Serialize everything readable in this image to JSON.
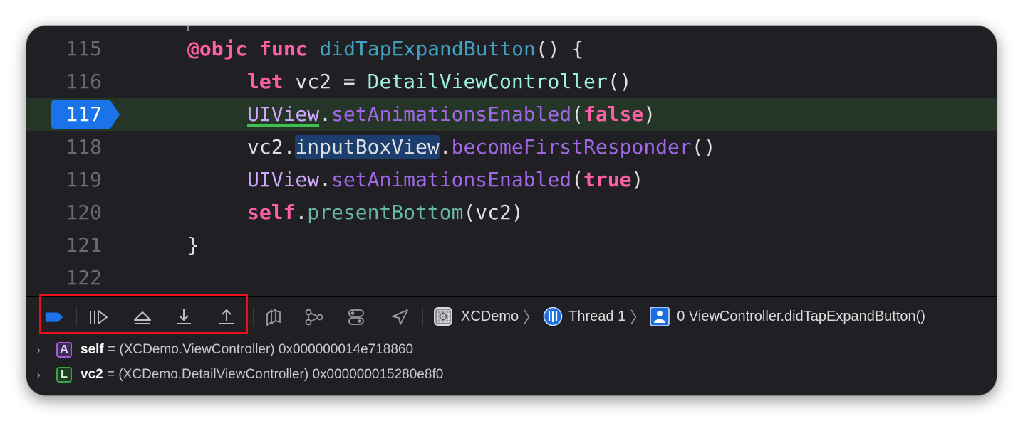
{
  "editor": {
    "lines": [
      {
        "num": "115",
        "segments": [
          {
            "t": "@objc",
            "c": "kw"
          },
          {
            "t": " ",
            "c": "ident"
          },
          {
            "t": "func",
            "c": "kw"
          },
          {
            "t": " ",
            "c": "ident"
          },
          {
            "t": "didTapExpandButton",
            "c": "fn-decl"
          },
          {
            "t": "() {",
            "c": "ident"
          }
        ]
      },
      {
        "num": "116",
        "segments": [
          {
            "t": "let",
            "c": "kw"
          },
          {
            "t": " vc2 = ",
            "c": "ident"
          },
          {
            "t": "DetailViewController",
            "c": "type"
          },
          {
            "t": "()",
            "c": "ident"
          }
        ]
      },
      {
        "num": "117",
        "segments": [
          {
            "t": "UIView",
            "c": "type-proj underline-green"
          },
          {
            "t": ".",
            "c": "ident"
          },
          {
            "t": "setAnimationsEnabled",
            "c": "method"
          },
          {
            "t": "(",
            "c": "ident"
          },
          {
            "t": "false",
            "c": "kw"
          },
          {
            "t": ")",
            "c": "ident"
          }
        ]
      },
      {
        "num": "118",
        "segments": [
          {
            "t": "vc2.",
            "c": "ident"
          },
          {
            "t": "inputBoxView",
            "c": "ident sel"
          },
          {
            "t": ".",
            "c": "ident"
          },
          {
            "t": "becomeFirstResponder",
            "c": "method"
          },
          {
            "t": "()",
            "c": "ident"
          }
        ]
      },
      {
        "num": "119",
        "segments": [
          {
            "t": "UIView",
            "c": "type-proj"
          },
          {
            "t": ".",
            "c": "ident"
          },
          {
            "t": "setAnimationsEnabled",
            "c": "method"
          },
          {
            "t": "(",
            "c": "ident"
          },
          {
            "t": "true",
            "c": "kw"
          },
          {
            "t": ")",
            "c": "ident"
          }
        ]
      },
      {
        "num": "120",
        "segments": [
          {
            "t": "self",
            "c": "kw"
          },
          {
            "t": ".",
            "c": "ident"
          },
          {
            "t": "presentBottom",
            "c": "method-proj"
          },
          {
            "t": "(vc2)",
            "c": "ident"
          }
        ]
      },
      {
        "num": "121",
        "segments": [
          {
            "t": "}",
            "c": "ident"
          }
        ]
      },
      {
        "num": "122",
        "segments": []
      }
    ],
    "current_line": "117",
    "colors": {
      "keyword": "#fc5fa3",
      "function_declaration": "#41a1c0",
      "type": "#9ef1dd",
      "method": "#a167e6",
      "breakpoint": "#1a73e8",
      "current_line_bg": "#253528"
    }
  },
  "debug_bar": {
    "buttons": [
      {
        "name": "breakpoints-toggle-button",
        "icon": "breakpoint-icon"
      },
      {
        "name": "continue-button",
        "icon": "continue-icon"
      },
      {
        "name": "step-over-button",
        "icon": "step-over-icon"
      },
      {
        "name": "step-into-button",
        "icon": "step-into-icon"
      },
      {
        "name": "step-out-button",
        "icon": "step-out-icon"
      },
      {
        "name": "debug-view-hierarchy-button",
        "icon": "view-hierarchy-icon"
      },
      {
        "name": "debug-memory-graph-button",
        "icon": "memory-graph-icon"
      },
      {
        "name": "environment-overrides-button",
        "icon": "environment-overrides-icon"
      },
      {
        "name": "simulate-location-button",
        "icon": "location-icon"
      }
    ],
    "breadcrumb": {
      "target": "XCDemo",
      "thread": "Thread 1",
      "frame": "0 ViewController.didTapExpandButton()"
    }
  },
  "variables": [
    {
      "badge": "A",
      "name": "self",
      "type": " = (XCDemo.ViewController) ",
      "value": "0x000000014e718860"
    },
    {
      "badge": "L",
      "name": "vc2",
      "type": " = (XCDemo.DetailViewController) ",
      "value": "0x000000015280e8f0"
    }
  ]
}
